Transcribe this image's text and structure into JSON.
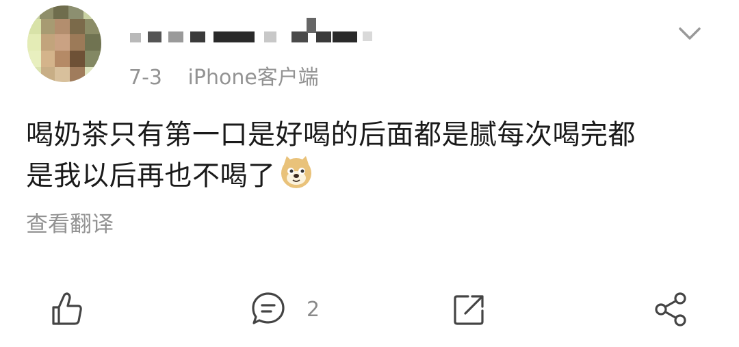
{
  "post": {
    "author": {
      "name_hidden": true
    },
    "date": "7-3",
    "source": "iPhone客户端",
    "text_line1": "喝奶茶只有第一口是好喝的后面都是腻每次喝完都",
    "text_line2": "是我以后再也不喝了",
    "emoji": "doge-emoji",
    "translate_label": "查看翻译"
  },
  "actions": {
    "like_icon": "thumbs-up-icon",
    "comment_icon": "comment-icon",
    "comment_count": "2",
    "repost_icon": "repost-icon",
    "share_icon": "share-icon"
  },
  "colors": {
    "text": "#1a1a1a",
    "meta": "#939393",
    "icon": "#444444"
  }
}
